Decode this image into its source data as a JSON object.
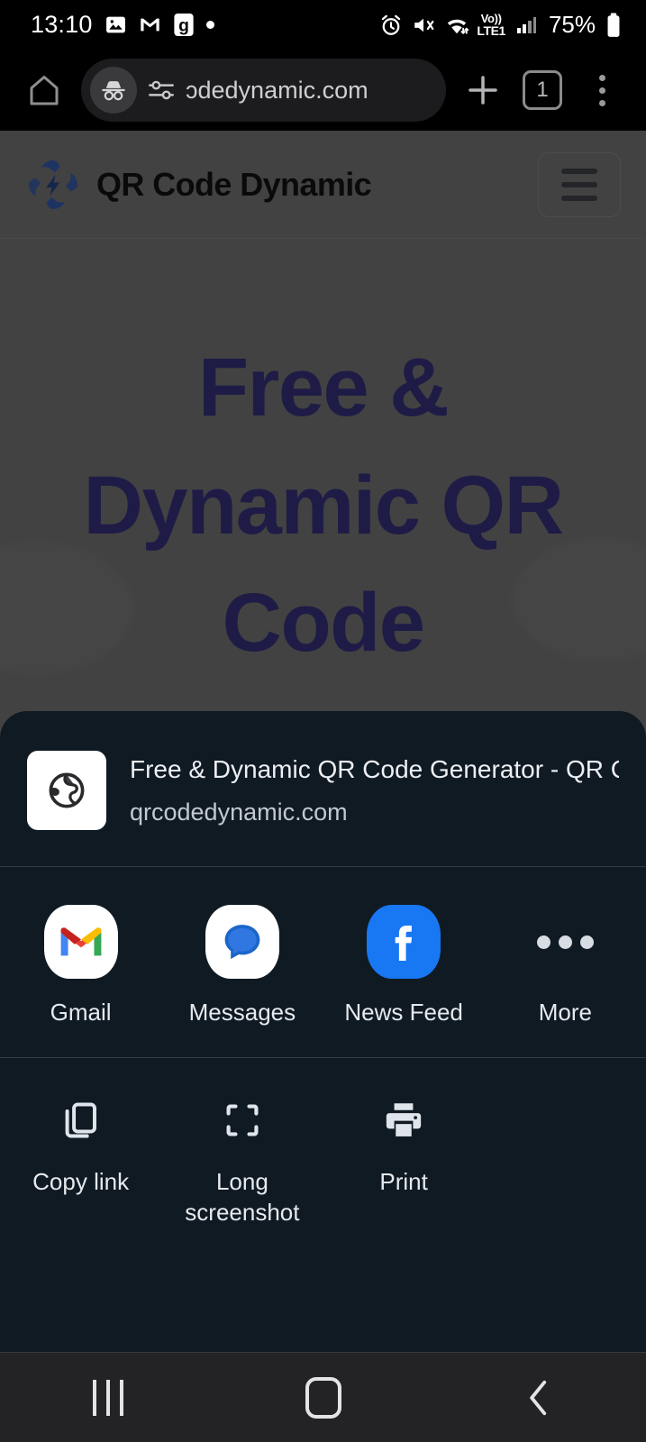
{
  "status_bar": {
    "time": "13:10",
    "left_icons": [
      "image-icon",
      "gmail-icon",
      "g-app-icon",
      "dot-indicator"
    ],
    "right_icons": [
      "alarm-icon",
      "mute-icon",
      "wifi-icon",
      "signal-icon"
    ],
    "volte_top": "Vo))",
    "volte_bottom": "LTE1",
    "battery_percent": "75%"
  },
  "browser_toolbar": {
    "home_icon": "home-icon",
    "incognito_icon": "incognito-icon",
    "tune_icon": "tune-icon",
    "url": "ɔdedynamic.com",
    "new_tab_icon": "plus-icon",
    "tab_count": "1",
    "menu_icon": "three-dot-menu-icon"
  },
  "site": {
    "brand_name": "QR Code Dynamic",
    "logo_icon": "qr-code-dynamic-logo",
    "menu_button_icon": "hamburger-icon",
    "hero_heading": "Free & Dynamic QR Code Generator",
    "colors": {
      "heading": "#332f76",
      "logo_blue": "#2d53a8",
      "page_bg": "#6e6e6e"
    }
  },
  "share_sheet": {
    "page_title": "Free & Dynamic QR Code Generator - QR C…",
    "page_domain": "qrcodedynamic.com",
    "favicon_icon": "globe-icon",
    "apps": [
      {
        "label": "Gmail",
        "icon": "gmail-icon"
      },
      {
        "label": "Messages",
        "icon": "messages-icon"
      },
      {
        "label": "News Feed",
        "icon": "facebook-icon"
      },
      {
        "label": "More",
        "icon": "more-dots-icon"
      }
    ],
    "actions": [
      {
        "label": "Copy link",
        "icon": "copy-link-icon"
      },
      {
        "label": "Long screenshot",
        "icon": "long-screenshot-icon"
      },
      {
        "label": "Print",
        "icon": "print-icon"
      }
    ],
    "colors": {
      "sheet_bg": "#101a22",
      "divider": "#333c44"
    }
  },
  "nav_bar": {
    "recents_icon": "recents-icon",
    "home_icon": "home-button-icon",
    "back_icon": "back-icon"
  }
}
